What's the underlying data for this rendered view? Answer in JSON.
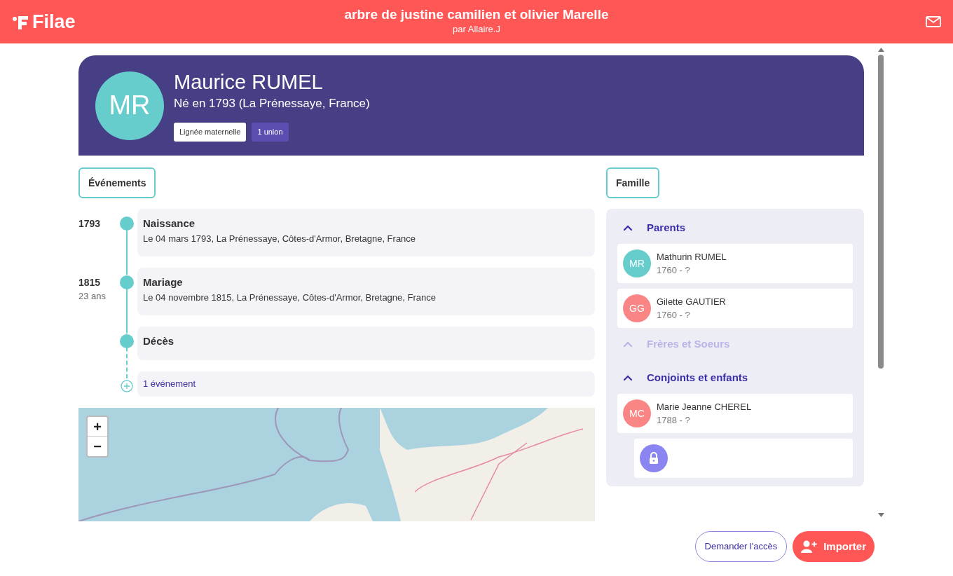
{
  "header": {
    "logo": "Filae",
    "title": "arbre de justine camilien et olivier Marelle",
    "subtitle": "par Allaire.J"
  },
  "person": {
    "initials": "MR",
    "name": "Maurice RUMEL",
    "birth": "Né en 1793 (La Prénessaye, France)",
    "tags": [
      {
        "label": "Lignée maternelle",
        "kind": "outline"
      },
      {
        "label": "1 union",
        "kind": "filled"
      }
    ]
  },
  "events_tab": "Événements",
  "events": [
    {
      "year": "1793",
      "title": "Naissance",
      "detail": "Le 04 mars 1793, La Prénessaye, Côtes-d'Armor, Bretagne, France"
    },
    {
      "year": "1815",
      "age": "23 ans",
      "title": "Mariage",
      "detail": "Le 04 novembre 1815, La Prénessaye, Côtes-d'Armor, Bretagne, France"
    },
    {
      "title": "Décès"
    }
  ],
  "more_events": "1 événement",
  "map": {
    "zoom_in": "+",
    "zoom_out": "−"
  },
  "family_tab": "Famille",
  "family": [
    {
      "title": "Parents",
      "disabled": false,
      "members": [
        {
          "initials": "MR",
          "name": "Mathurin RUMEL",
          "dates": "1760 - ?",
          "color": "#66cccc",
          "kind": "person"
        },
        {
          "initials": "GG",
          "name": "Gilette GAUTIER",
          "dates": "1760 - ?",
          "color": "#f98585",
          "kind": "person"
        }
      ]
    },
    {
      "title": "Frères et Soeurs",
      "disabled": true
    },
    {
      "title": "Conjoints et enfants",
      "disabled": false,
      "members": [
        {
          "initials": "MC",
          "name": "Marie Jeanne CHEREL",
          "dates": "1788 - ?",
          "color": "#f98585",
          "kind": "person"
        },
        {
          "kind": "locked"
        }
      ]
    }
  ],
  "buttons": {
    "request": "Demander l'accès",
    "import": "Importer"
  }
}
